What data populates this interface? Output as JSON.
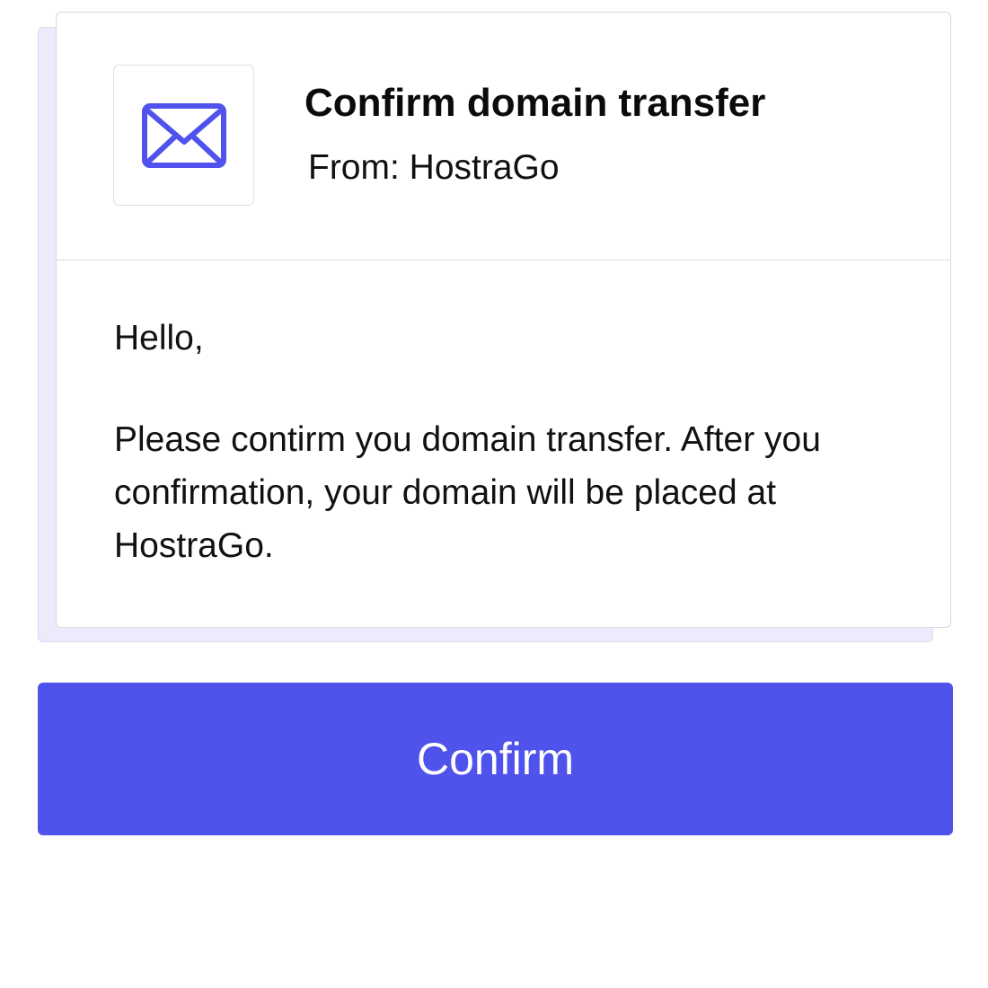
{
  "email": {
    "icon": "mail-icon",
    "subject": "Confirm domain transfer",
    "from": "From: HostraGo",
    "greeting": "Hello,",
    "message": "Please contirm you domain transfer. After you confirmation, your domain will be placed at HostraGo."
  },
  "actions": {
    "confirm_label": "Confirm"
  },
  "colors": {
    "accent": "#4f52eb",
    "card_shadow": "#eceafb",
    "text": "#111111"
  }
}
